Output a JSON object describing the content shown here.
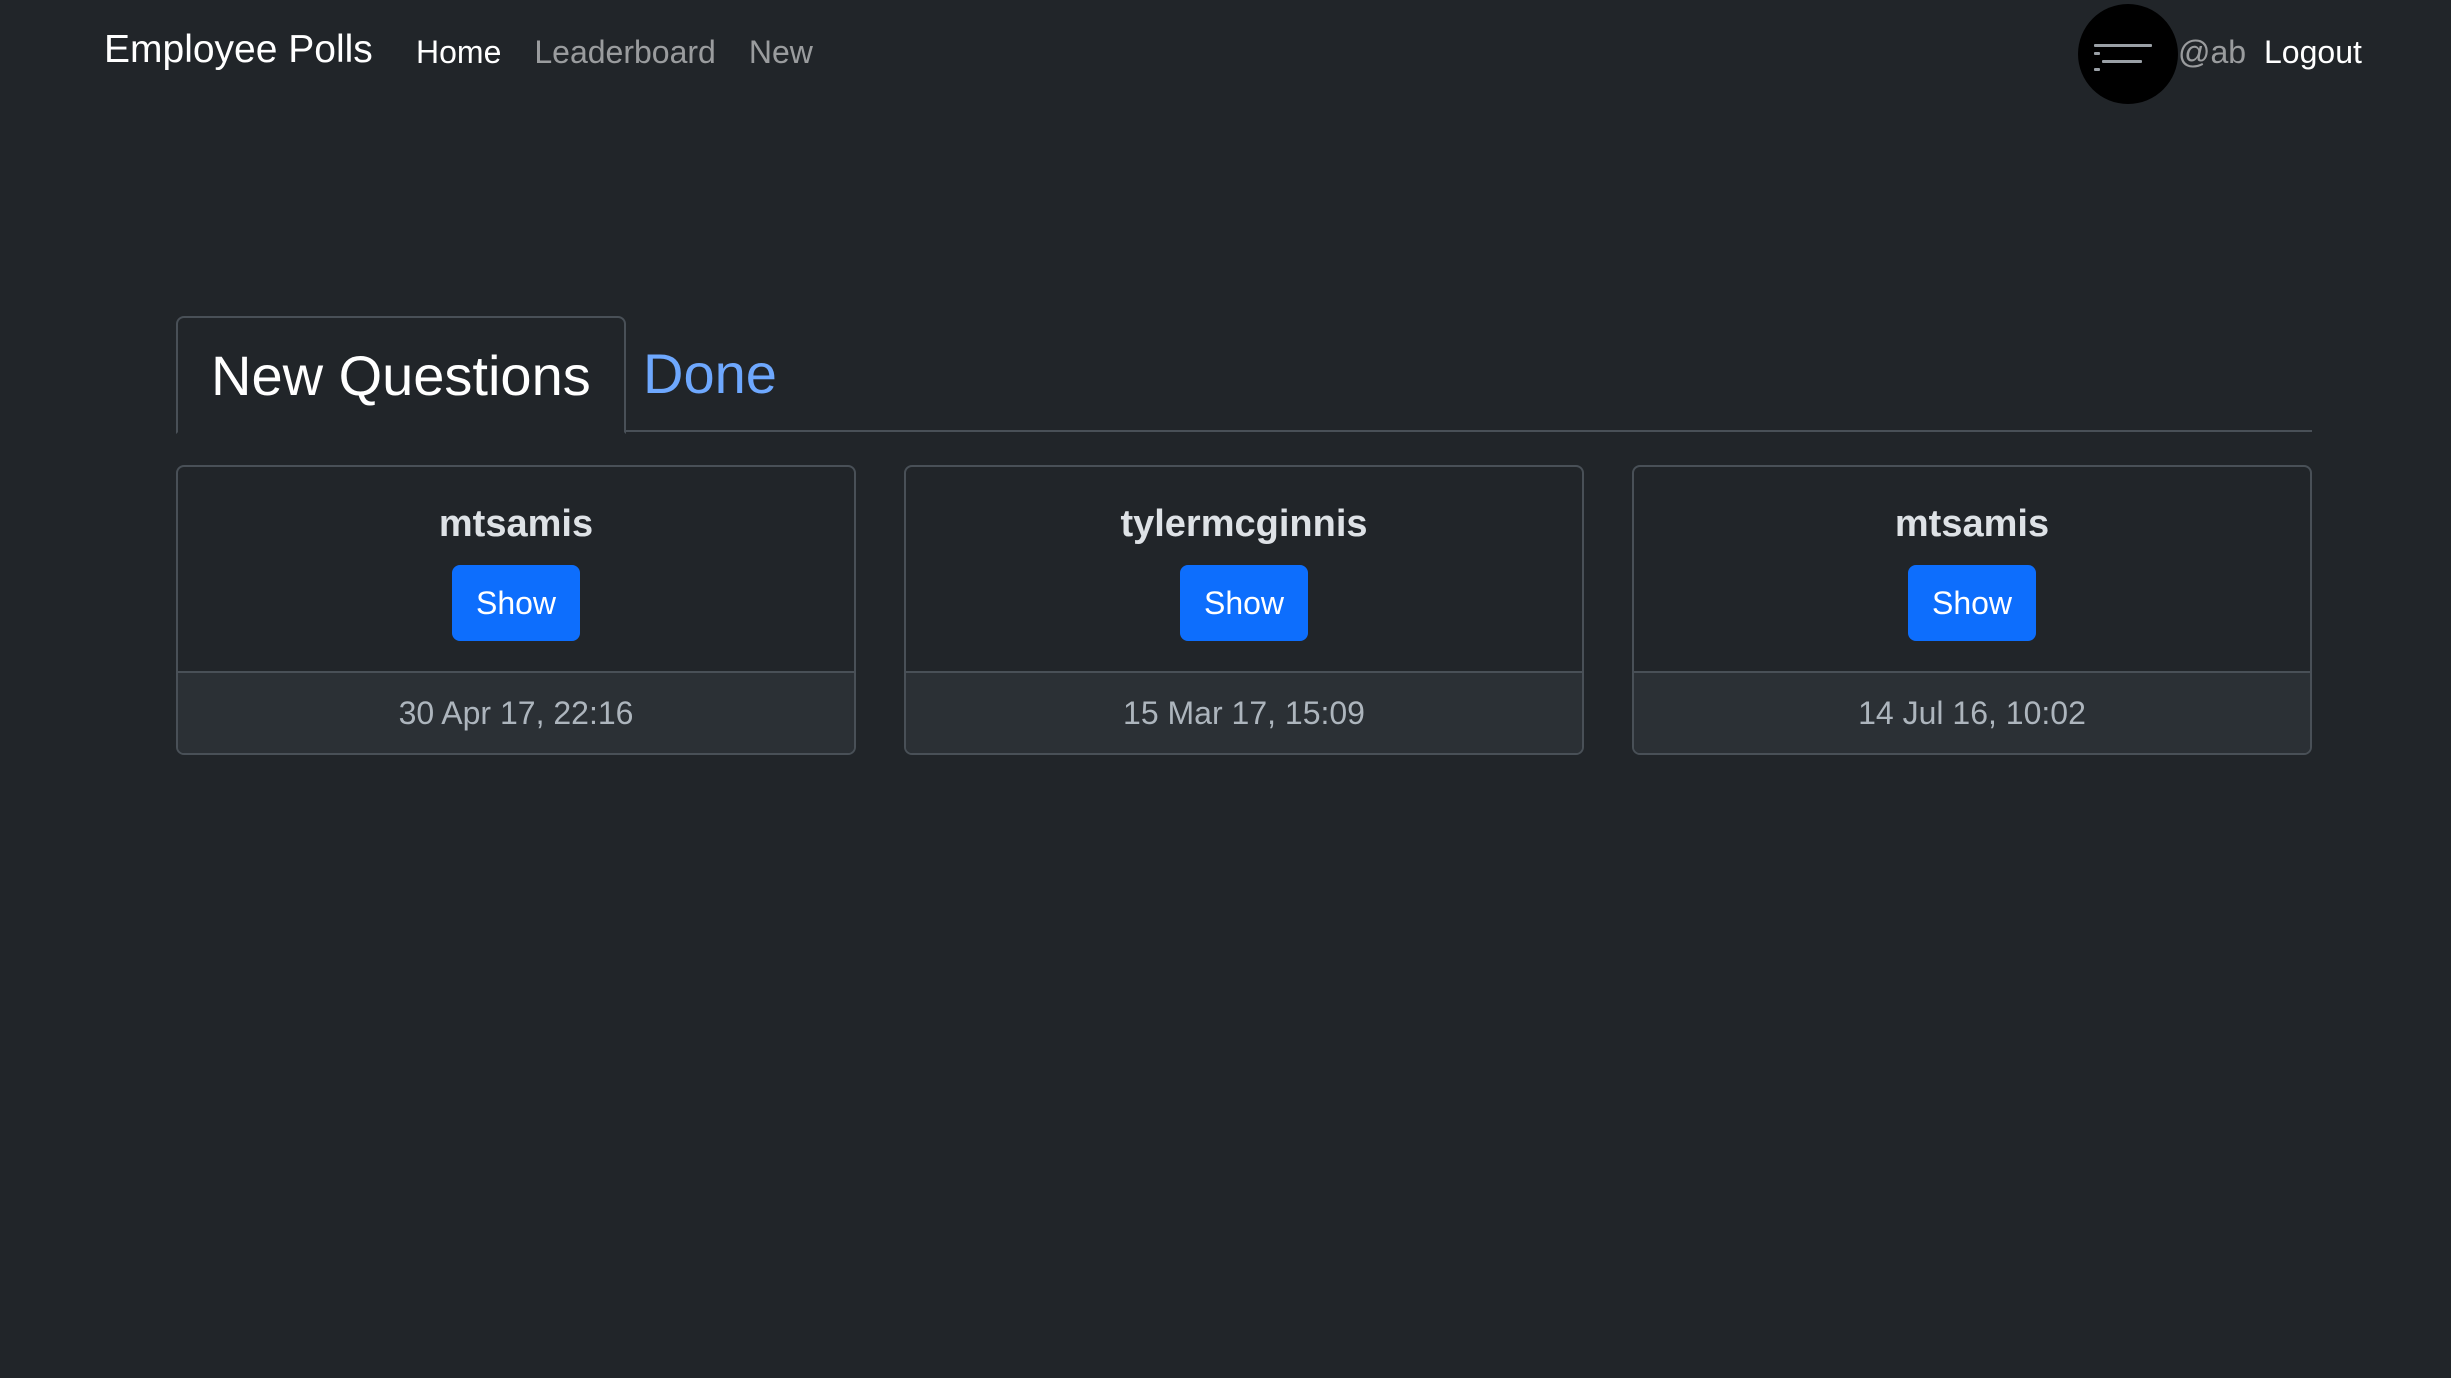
{
  "navbar": {
    "brand": "Employee Polls",
    "links": [
      {
        "label": "Home",
        "active": true
      },
      {
        "label": "Leaderboard",
        "active": false
      },
      {
        "label": "New",
        "active": false
      }
    ],
    "username": "@ab",
    "logout_label": "Logout"
  },
  "tabs": [
    {
      "label": "New Questions",
      "active": true
    },
    {
      "label": "Done",
      "active": false
    }
  ],
  "questions": [
    {
      "author": "mtsamis",
      "button_label": "Show",
      "timestamp": "30 Apr 17, 22:16"
    },
    {
      "author": "tylermcginnis",
      "button_label": "Show",
      "timestamp": "15 Mar 17, 15:09"
    },
    {
      "author": "mtsamis",
      "button_label": "Show",
      "timestamp": "14 Jul 16, 10:02"
    }
  ],
  "colors": {
    "background": "#212529",
    "primary": "#0d6efd",
    "link_inactive_tab": "#6ea8fe",
    "border": "#495057"
  },
  "icons": {
    "avatar": "user-avatar-code-image"
  }
}
